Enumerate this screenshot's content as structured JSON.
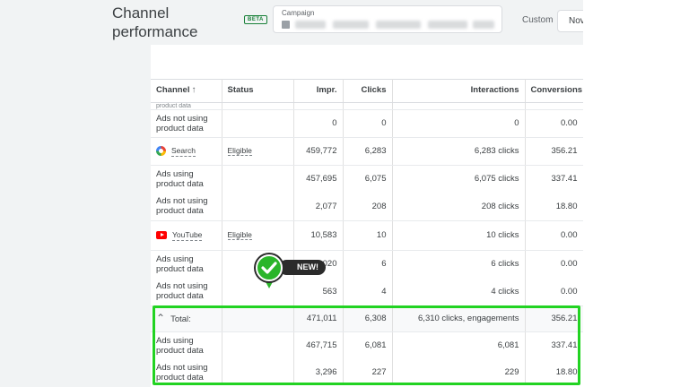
{
  "header": {
    "title": "Channel performance",
    "beta": "BETA",
    "campaign_label": "Campaign",
    "custom_label": "Custom",
    "date_button": "Nov"
  },
  "table": {
    "columns": [
      "Channel",
      "Status",
      "Impr.",
      "Clicks",
      "Interactions",
      "Conversions"
    ],
    "sort_icon": "arrow-up-icon",
    "partial_top_text": "product data",
    "rows": [
      {
        "channel": "Ads not using product data",
        "status": "",
        "impr": "0",
        "clicks": "0",
        "interactions": "0",
        "conversions": "0.00"
      },
      {
        "channel": "Search",
        "icon": "google-icon",
        "status": "Eligible",
        "impr": "459,772",
        "clicks": "6,283",
        "interactions": "6,283 clicks",
        "conversions": "356.21"
      },
      {
        "channel": "Ads using product data",
        "status": "",
        "impr": "457,695",
        "clicks": "6,075",
        "interactions": "6,075 clicks",
        "conversions": "337.41"
      },
      {
        "channel": "Ads not using product data",
        "status": "",
        "impr": "2,077",
        "clicks": "208",
        "interactions": "208 clicks",
        "conversions": "18.80"
      },
      {
        "channel": "YouTube",
        "icon": "youtube-icon",
        "status": "Eligible",
        "impr": "10,583",
        "clicks": "10",
        "interactions": "10 clicks",
        "conversions": "0.00"
      },
      {
        "channel": "Ads using product data",
        "status": "",
        "impr": "020",
        "clicks": "6",
        "interactions": "6 clicks",
        "conversions": "0.00"
      },
      {
        "channel": "Ads not using product data",
        "status": "",
        "impr": "563",
        "clicks": "4",
        "interactions": "4 clicks",
        "conversions": "0.00"
      }
    ],
    "total": {
      "label": "Total:",
      "impr": "471,011",
      "clicks": "6,308",
      "interactions": "6,310 clicks, engagements",
      "conversions": "356.21"
    },
    "total_rows": [
      {
        "channel": "Ads using product data",
        "impr": "467,715",
        "clicks": "6,081",
        "interactions": "6,081",
        "conversions": "337.41"
      },
      {
        "channel": "Ads not using product data",
        "impr": "3,296",
        "clicks": "227",
        "interactions": "229",
        "conversions": "18.80"
      }
    ]
  },
  "badge": {
    "text": "NEW!",
    "color": "#2ab52a"
  },
  "highlight_color": "#22d322"
}
